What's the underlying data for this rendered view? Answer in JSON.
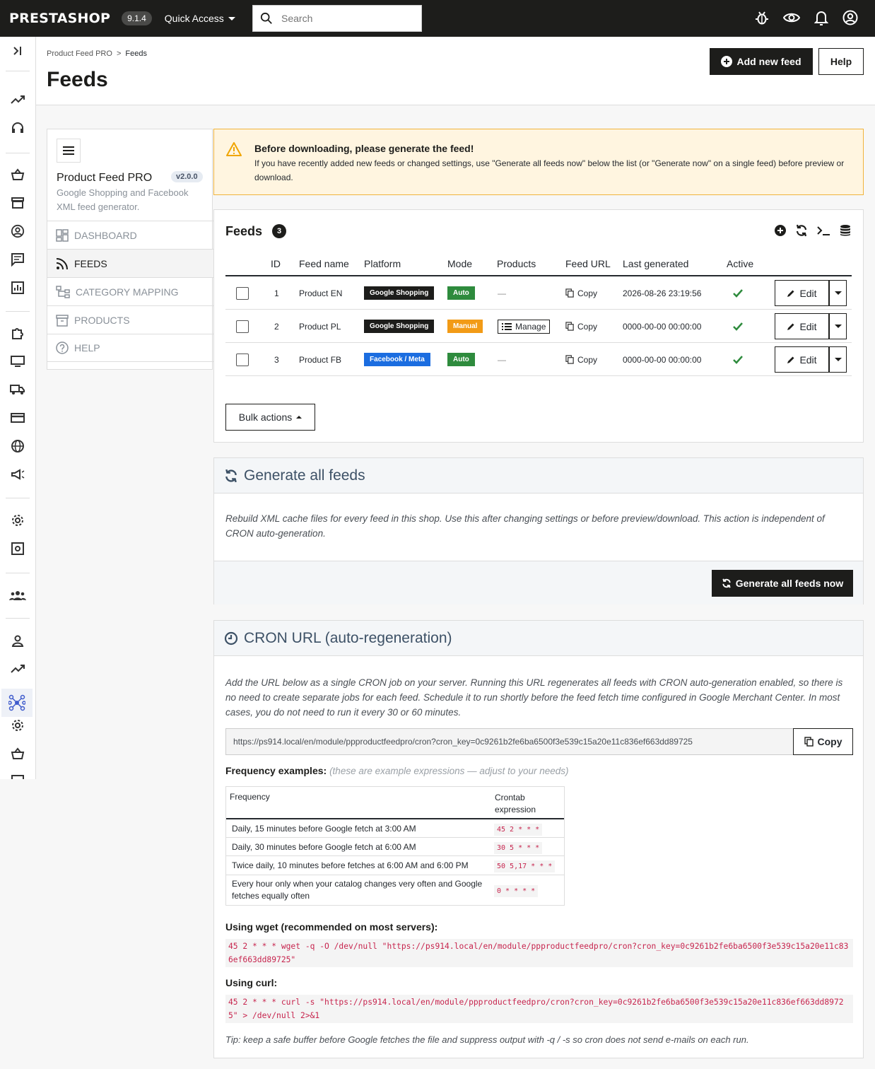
{
  "app": {
    "logo": "PRESTASHOP",
    "version": "9.1.4",
    "quick_access": "Quick Access",
    "search_placeholder": "Search"
  },
  "breadcrumb": {
    "parent": "Product Feed PRO",
    "sep": ">",
    "current": "Feeds"
  },
  "page_title": "Feeds",
  "header_buttons": {
    "add": "Add new feed",
    "help": "Help"
  },
  "module": {
    "name": "Product Feed PRO",
    "version": "v2.0.0",
    "desc": "Google Shopping and Facebook XML feed generator.",
    "menu": [
      {
        "label": "DASHBOARD",
        "icon": "dashboard-icon"
      },
      {
        "label": "FEEDS",
        "icon": "rss-icon"
      },
      {
        "label": "CATEGORY MAPPING",
        "icon": "sitemap-icon"
      },
      {
        "label": "PRODUCTS",
        "icon": "archive-icon"
      },
      {
        "label": "HELP",
        "icon": "help-icon"
      }
    ]
  },
  "alert": {
    "title": "Before downloading, please generate the feed!",
    "text": "If you have recently added new feeds or changed settings, use \"Generate all feeds now\" below the list (or \"Generate now\" on a single feed) before preview or download."
  },
  "feeds": {
    "title": "Feeds",
    "count": "3",
    "columns": {
      "id": "ID",
      "name": "Feed name",
      "platform": "Platform",
      "mode": "Mode",
      "products": "Products",
      "url": "Feed URL",
      "last": "Last generated",
      "active": "Active"
    },
    "rows": [
      {
        "id": "1",
        "name": "Product EN",
        "platform": "Google Shopping",
        "mode": "Auto",
        "products": "—",
        "url": "Copy",
        "last": "2026-08-26 23:19:56",
        "edit": "Edit"
      },
      {
        "id": "2",
        "name": "Product PL",
        "platform": "Google Shopping",
        "mode": "Manual",
        "products": "Manage",
        "url": "Copy",
        "last": "0000-00-00 00:00:00",
        "edit": "Edit"
      },
      {
        "id": "3",
        "name": "Product FB",
        "platform": "Facebook / Meta",
        "mode": "Auto",
        "products": "—",
        "url": "Copy",
        "last": "0000-00-00 00:00:00",
        "edit": "Edit"
      }
    ],
    "bulk": "Bulk actions"
  },
  "generate": {
    "title": "Generate all feeds",
    "text": "Rebuild XML cache files for every feed in this shop. Use this after changing settings or before preview/download. This action is independent of CRON auto-generation.",
    "button": "Generate all feeds now"
  },
  "cron": {
    "title": "CRON URL (auto-regeneration)",
    "text": "Add the URL below as a single CRON job on your server. Running this URL regenerates all feeds with CRON auto-generation enabled, so there is no need to create separate jobs for each feed. Schedule it to run shortly before the feed fetch time configured in Google Merchant Center. In most cases, you do not need to run it every 30 or 60 minutes.",
    "url": "https://ps914.local/en/module/ppproductfeedpro/cron?cron_key=0c9261b2fe6ba6500f3e539c15a20e11c836ef663dd89725",
    "copy": "Copy",
    "freq_label": "Frequency examples:",
    "freq_note": "(these are example expressions — adjust to your needs)",
    "freq_head": {
      "frequency": "Frequency",
      "expr": "Crontab expression"
    },
    "freq_rows": [
      {
        "f": "Daily, 15 minutes before Google fetch at 3:00 AM",
        "e": "45 2 * * *"
      },
      {
        "f": "Daily, 30 minutes before Google fetch at 6:00 AM",
        "e": "30 5 * * *"
      },
      {
        "f": "Twice daily, 10 minutes before fetches at 6:00 AM and 6:00 PM",
        "e": "50 5,17 * * *"
      },
      {
        "f": "Every hour only when your catalog changes very often and Google fetches equally often",
        "e": "0 * * * *"
      }
    ],
    "wget_label": "Using wget (recommended on most servers):",
    "wget_cmd": "45 2 * * * wget -q -O /dev/null \"https://ps914.local/en/module/ppproductfeedpro/cron?cron_key=0c9261b2fe6ba6500f3e539c15a20e11c836ef663dd89725\"",
    "curl_label": "Using curl:",
    "curl_cmd": "45 2 * * * curl -s \"https://ps914.local/en/module/ppproductfeedpro/cron?cron_key=0c9261b2fe6ba6500f3e539c15a20e11c836ef663dd89725\" > /dev/null 2>&1",
    "tip": "Tip: keep a safe buffer before Google fetches the file and suppress output with -q / -s so cron does not send e-mails on each run."
  },
  "colors": {
    "dark": "#1d1d1b",
    "auto": "#2e8b3d",
    "manual": "#f29b16",
    "facebook": "#1b6de0",
    "warning": "#f0b43c"
  }
}
